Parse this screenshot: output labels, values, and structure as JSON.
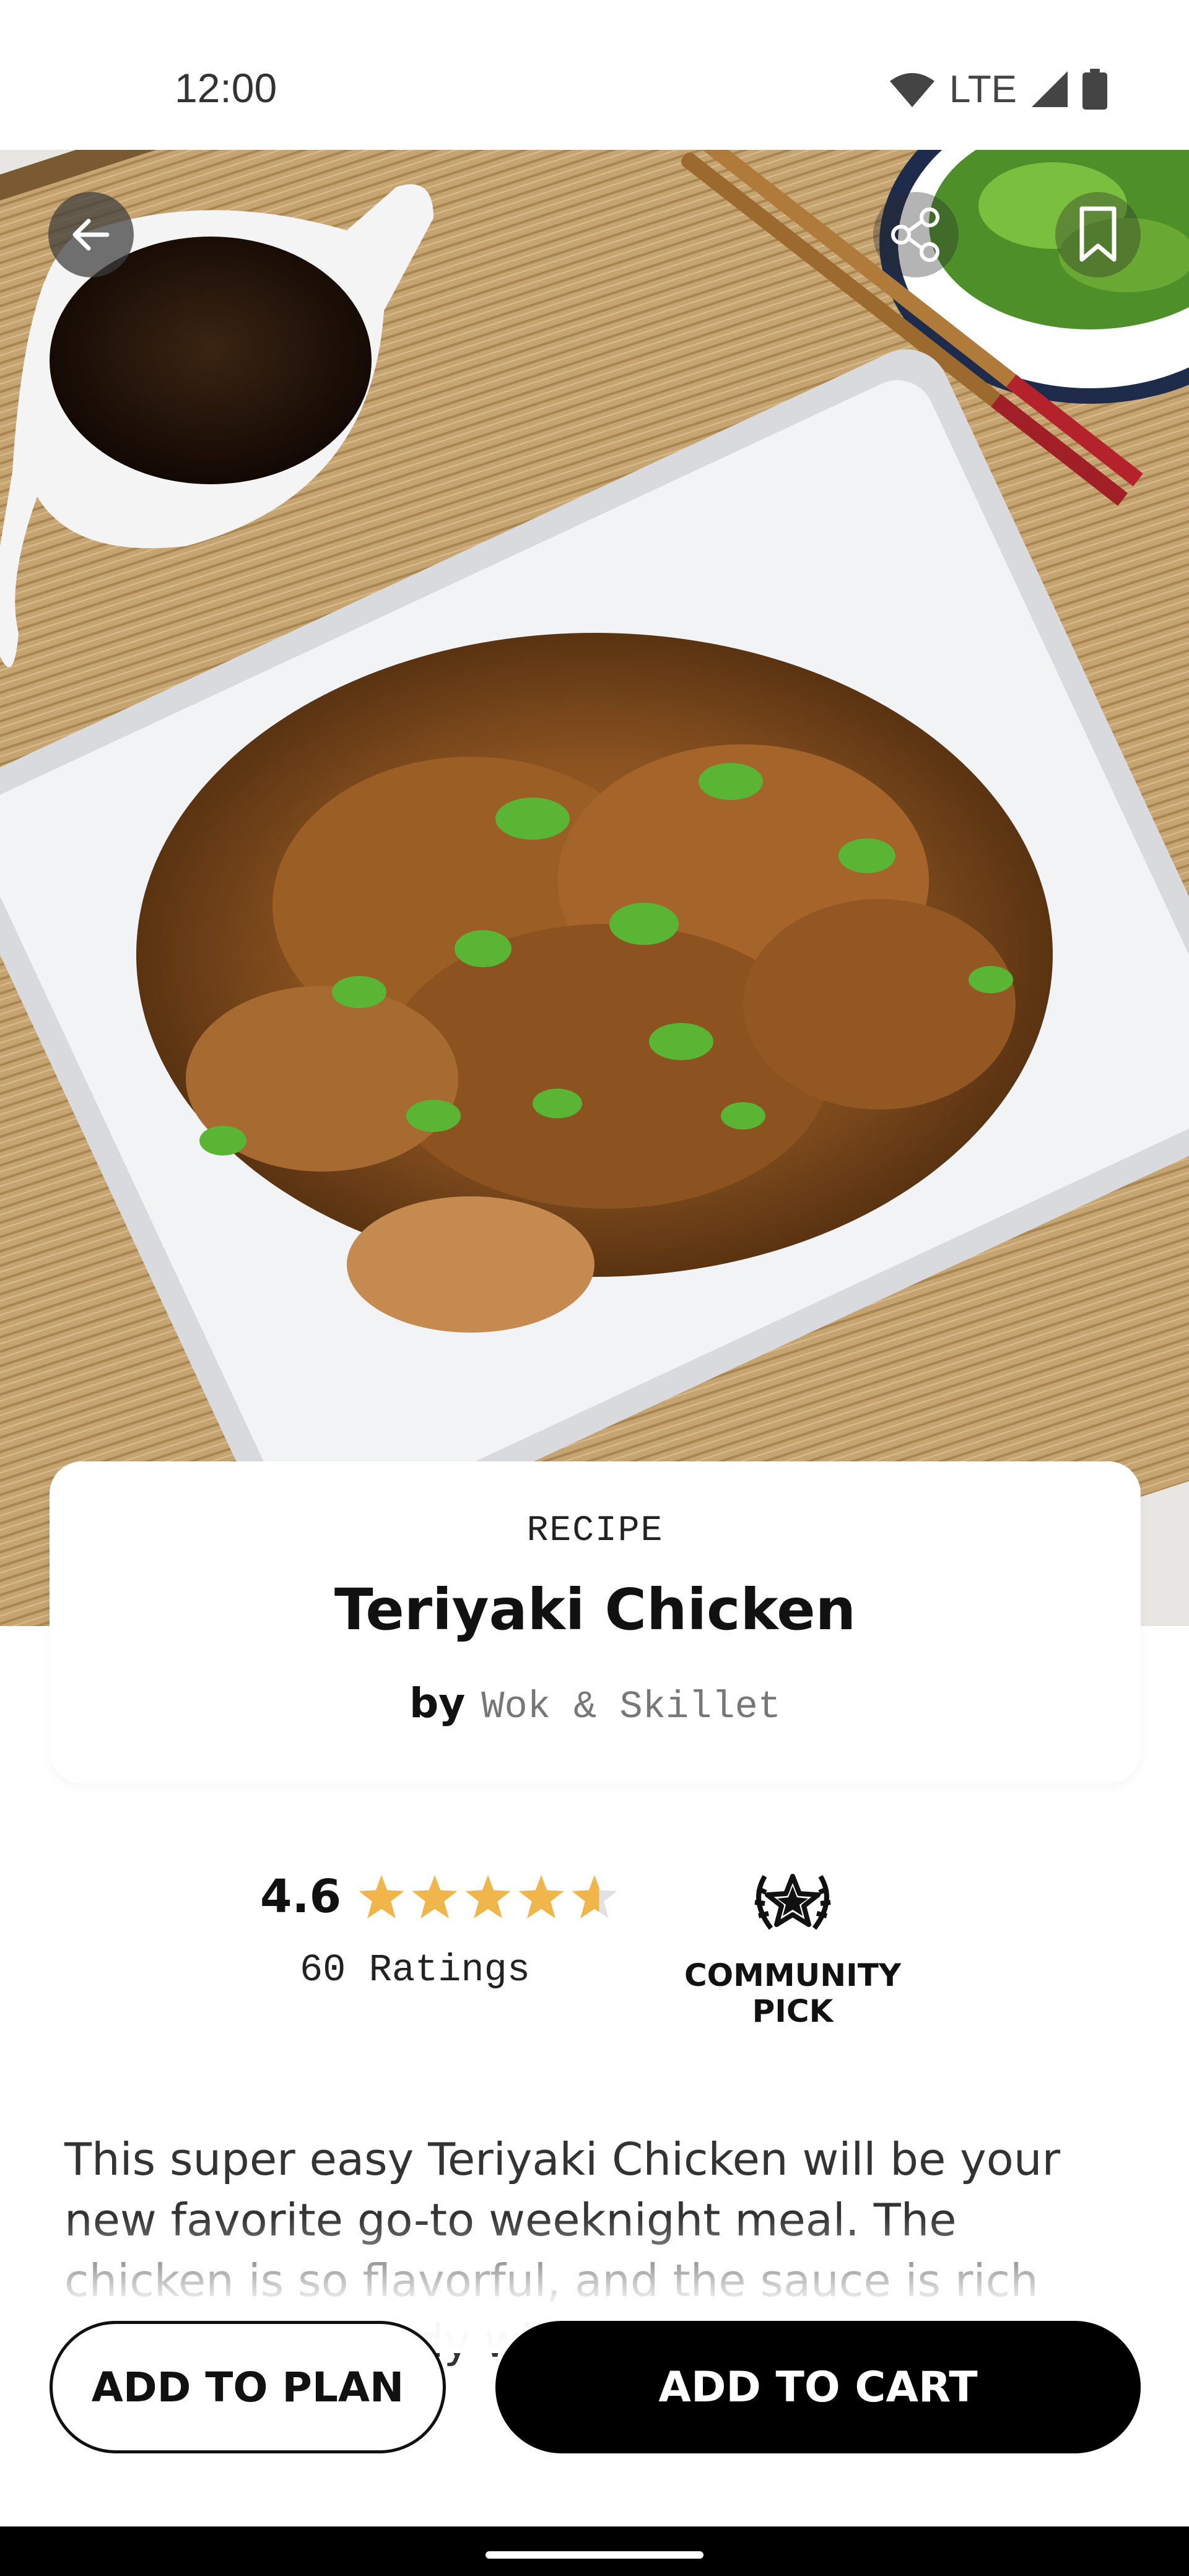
{
  "status_bar": {
    "time": "12:00",
    "network": "LTE",
    "icons": [
      "wifi-icon",
      "cell-signal-icon",
      "battery-icon"
    ]
  },
  "hero": {
    "image_description_icon": "teriyaki-chicken-photo",
    "actions": [
      "back-arrow-icon",
      "share-icon",
      "bookmark-icon"
    ]
  },
  "recipe": {
    "kicker": "RECIPE",
    "title": "Teriyaki Chicken",
    "by_label": "by",
    "author": "Wok & Skillet"
  },
  "rating": {
    "value": "4.6",
    "stars": 4.6,
    "star_max": 5,
    "count_label": "60 Ratings",
    "star_color": "#F0B64C"
  },
  "badge": {
    "label": "COMMUNITY PICK",
    "icon": "laurel-star-icon"
  },
  "description": {
    "text": "This super easy Teriyaki Chicken will be your new favorite go-to weeknight meal. The chicken is so flavorful, and the sauce is rich and thick. Nobody will know just"
  },
  "actions": {
    "add_to_plan": "ADD TO PLAN",
    "add_to_cart": "ADD TO CART"
  }
}
